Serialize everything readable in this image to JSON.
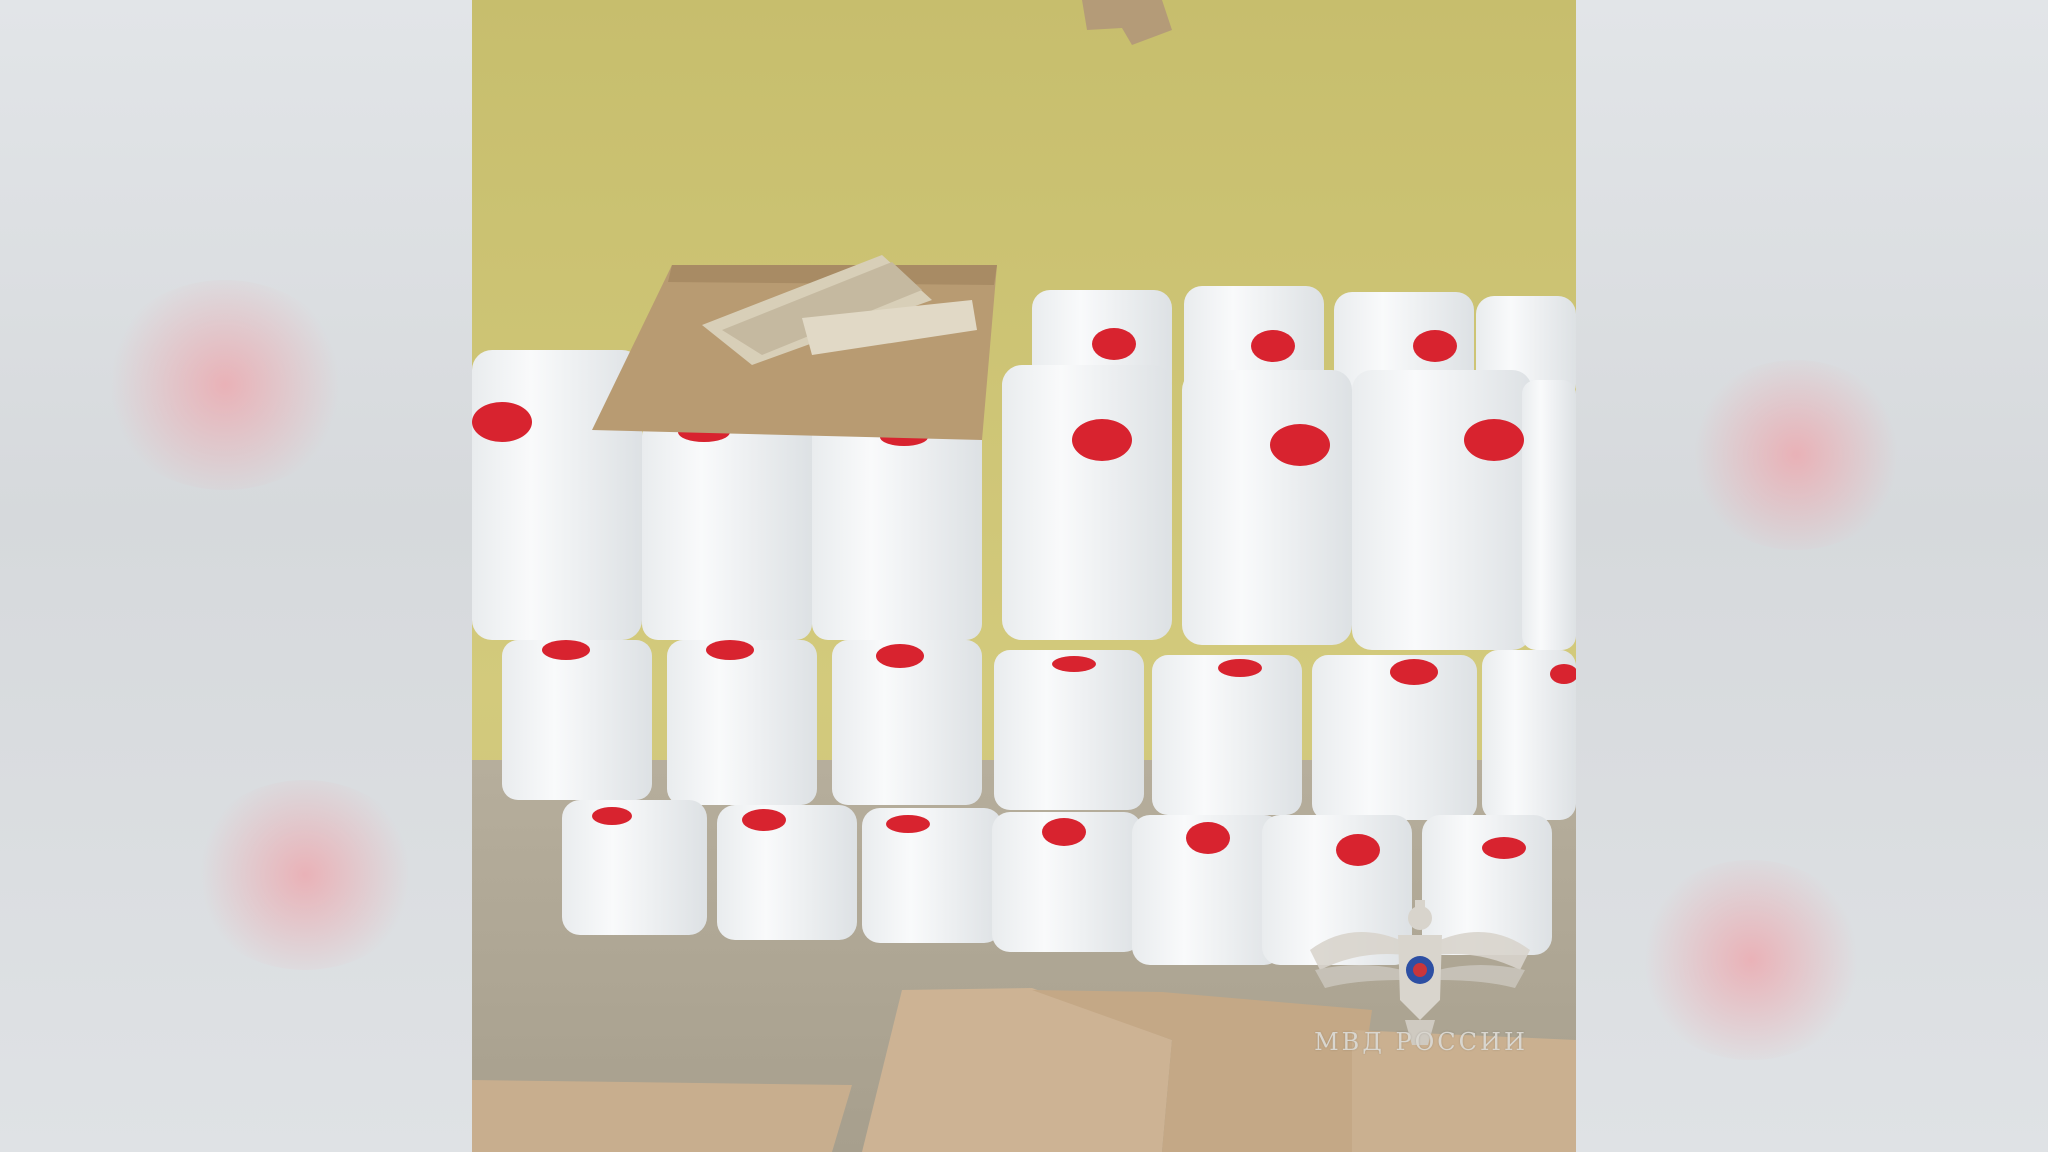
{
  "scene": {
    "subject": "stack-of-white-canisters-with-red-caps",
    "background": "yellow-painted-wall",
    "floor": "cardboard-sheets"
  },
  "watermark": {
    "emblem": "double-headed-eagle-emblem",
    "text": "МВД РОССИИ"
  },
  "colors": {
    "wall": "#cfc677",
    "canister": "#f4f6f7",
    "cap": "#d8232f",
    "cardboard": "#c8ae8e",
    "blurred_side": "#dcdfe2"
  }
}
